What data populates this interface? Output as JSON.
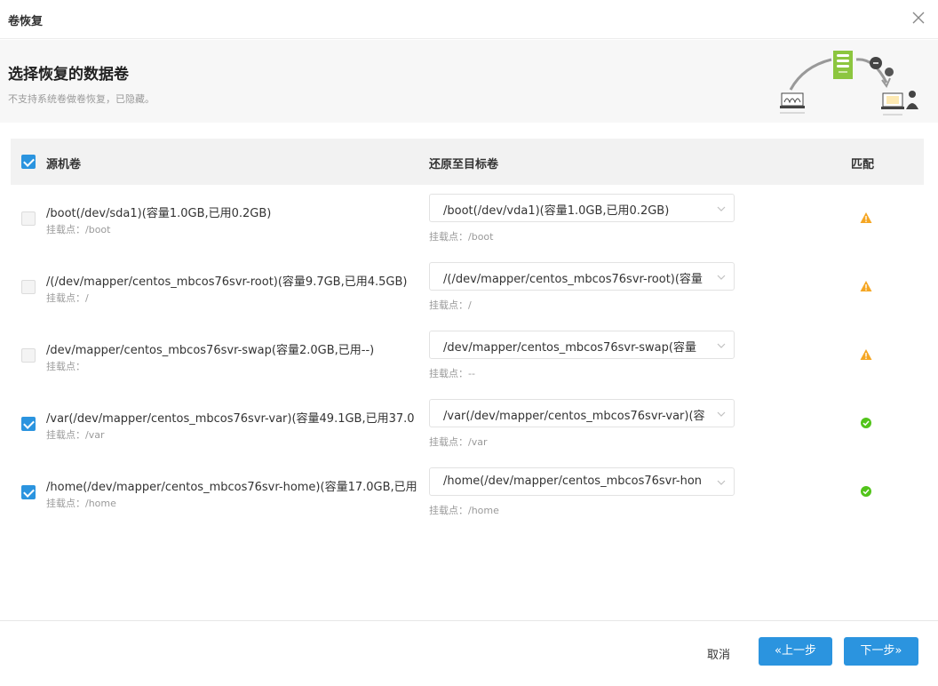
{
  "dialog": {
    "title": "卷恢复",
    "header": {
      "title": "选择恢复的数据卷",
      "subtitle": "不支持系统卷做卷恢复，已隐藏。"
    },
    "table": {
      "col_source": "源机卷",
      "col_target": "还原至目标卷",
      "col_match": "匹配",
      "select_all": true,
      "rows": [
        {
          "checked": false,
          "source": "/boot(/dev/sda1)(容量1.0GB,已用0.2GB)",
          "source_mount": "挂载点：/boot",
          "target": "/boot(/dev/vda1)(容量1.0GB,已用0.2GB)",
          "target_mount": "挂载点：/boot",
          "match": "warning"
        },
        {
          "checked": false,
          "source": "/(/dev/mapper/centos_mbcos76svr-root)(容量9.7GB,已用4.5GB)",
          "source_mount": "挂载点：/",
          "target": "/(/dev/mapper/centos_mbcos76svr-root)(容量",
          "target_mount": "挂载点：/",
          "match": "warning"
        },
        {
          "checked": false,
          "source": "/dev/mapper/centos_mbcos76svr-swap(容量2.0GB,已用--)",
          "source_mount": "挂载点：",
          "target": "/dev/mapper/centos_mbcos76svr-swap(容量",
          "target_mount": "挂载点：--",
          "match": "warning"
        },
        {
          "checked": true,
          "source": "/var(/dev/mapper/centos_mbcos76svr-var)(容量49.1GB,已用37.0",
          "source_mount": "挂载点：/var",
          "target": "/var(/dev/mapper/centos_mbcos76svr-var)(容",
          "target_mount": "挂载点：/var",
          "match": "ok"
        },
        {
          "checked": true,
          "source": "/home(/dev/mapper/centos_mbcos76svr-home)(容量17.0GB,已用",
          "source_mount": "挂载点：/home",
          "target": "/home(/dev/mapper/centos_mbcos76svr-hon",
          "target_mount": "挂载点：/home",
          "match": "ok"
        }
      ]
    },
    "footer": {
      "cancel": "取消",
      "prev": "«上一步",
      "next": "下一步»"
    },
    "colors": {
      "primary": "#2b94df",
      "warning": "#f5a623",
      "ok": "#52c41a"
    },
    "icons": {
      "close": "close-icon",
      "warning": "warning-icon",
      "ok": "check-circle-icon",
      "chevron": "chevron-down-icon"
    }
  }
}
